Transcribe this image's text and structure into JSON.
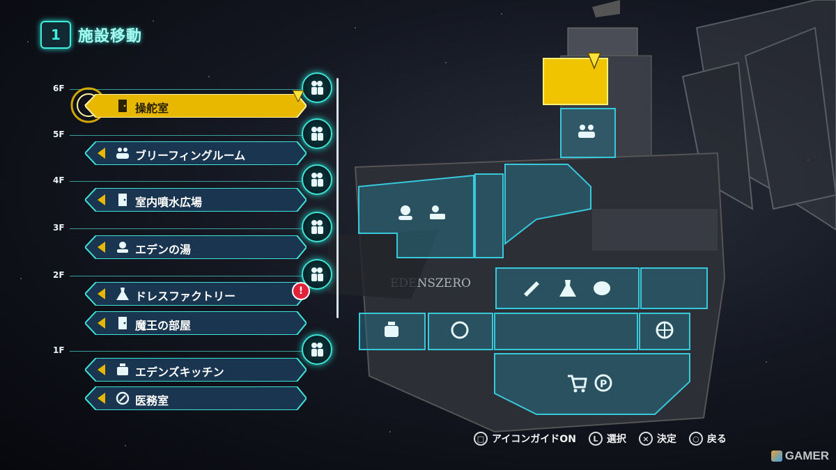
{
  "header": {
    "icon_text": "1",
    "title": "施設移動"
  },
  "floors": [
    {
      "label": "6F"
    },
    {
      "label": "5F"
    },
    {
      "label": "4F"
    },
    {
      "label": "3F"
    },
    {
      "label": "2F"
    },
    {
      "label": "1F"
    }
  ],
  "rooms": [
    {
      "label": "操舵室",
      "icon": "door-icon",
      "selected": true
    },
    {
      "label": "ブリーフィングルーム",
      "icon": "people-icon",
      "selected": false
    },
    {
      "label": "室内噴水広場",
      "icon": "door-icon",
      "selected": false
    },
    {
      "label": "エデンの湯",
      "icon": "bath-icon",
      "selected": false
    },
    {
      "label": "ドレスファクトリー",
      "icon": "dress-icon",
      "selected": false,
      "alert": "!"
    },
    {
      "label": "魔王の部屋",
      "icon": "door-icon",
      "selected": false
    },
    {
      "label": "エデンズキッチン",
      "icon": "pot-icon",
      "selected": false
    },
    {
      "label": "医務室",
      "icon": "medical-icon",
      "selected": false
    }
  ],
  "ship": {
    "nameplate": "EDENSZERO"
  },
  "footer": {
    "icon_guide": {
      "glyph": "□",
      "label": "アイコンガイドON"
    },
    "select": {
      "glyph": "L",
      "label": "選択"
    },
    "confirm": {
      "glyph": "×",
      "label": "決定"
    },
    "back": {
      "glyph": "○",
      "label": "戻る"
    }
  },
  "watermark": "GAMER",
  "colors": {
    "accent": "#3fe4d8",
    "selected": "#e8b800",
    "panel": "#1a3550"
  }
}
